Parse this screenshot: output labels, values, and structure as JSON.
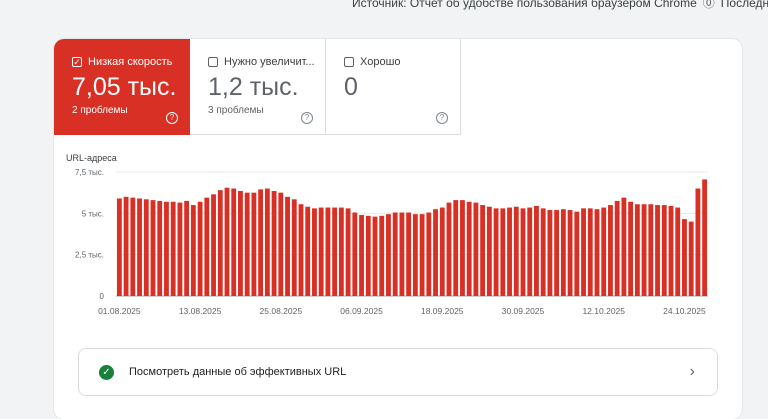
{
  "topbar": {
    "text": "Источник: Отчет об удобстве пользования браузером Chrome",
    "after": "Последнее"
  },
  "tiles": [
    {
      "label": "Низкая скорость",
      "value": "7,05 тыс.",
      "sub": "2 проблемы",
      "checked": true,
      "color": "#d93025"
    },
    {
      "label": "Нужно увеличит...",
      "value": "1,2 тыс.",
      "sub": "3 проблемы",
      "checked": false
    },
    {
      "label": "Хорошо",
      "value": "0",
      "sub": "",
      "checked": false
    }
  ],
  "chart_data": {
    "type": "bar",
    "ylabel": "URL-адреса",
    "ylim": [
      0,
      7500
    ],
    "y_ticks": [
      0,
      2500,
      5000,
      7500
    ],
    "y_tick_labels": [
      "0",
      "2,5 тыс.",
      "5 тыс.",
      "7,5 тыс."
    ],
    "x_tick_labels": [
      "01.08.2025",
      "13.08.2025",
      "25.08.2025",
      "06.09.2025",
      "18.09.2025",
      "30.09.2025",
      "12.10.2025",
      "24.10.2025"
    ],
    "bar_color": "#d93025",
    "series": [
      {
        "values": [
          5900,
          6000,
          5950,
          5900,
          5850,
          5800,
          5750,
          5700,
          5700,
          5650,
          5750,
          5500,
          5700,
          5950,
          6150,
          6400,
          6550,
          6500,
          6350,
          6250,
          6250,
          6450,
          6500,
          6350,
          6250,
          6000,
          5850,
          5550,
          5400,
          5300,
          5350,
          5350,
          5350,
          5350,
          5300,
          5050,
          4900,
          4850,
          4800,
          4850,
          4950,
          5050,
          5050,
          5050,
          4950,
          4950,
          5050,
          5250,
          5350,
          5650,
          5800,
          5800,
          5700,
          5650,
          5500,
          5400,
          5300,
          5300,
          5350,
          5400,
          5300,
          5350,
          5450,
          5300,
          5200,
          5200,
          5250,
          5200,
          5100,
          5300,
          5300,
          5250,
          5350,
          5500,
          5750,
          5950,
          5700,
          5550,
          5550,
          5550,
          5500,
          5500,
          5450,
          5350,
          4650,
          4500,
          6500,
          7050
        ]
      }
    ]
  },
  "link": {
    "text": "Посмотреть данные об эффективных URL"
  }
}
